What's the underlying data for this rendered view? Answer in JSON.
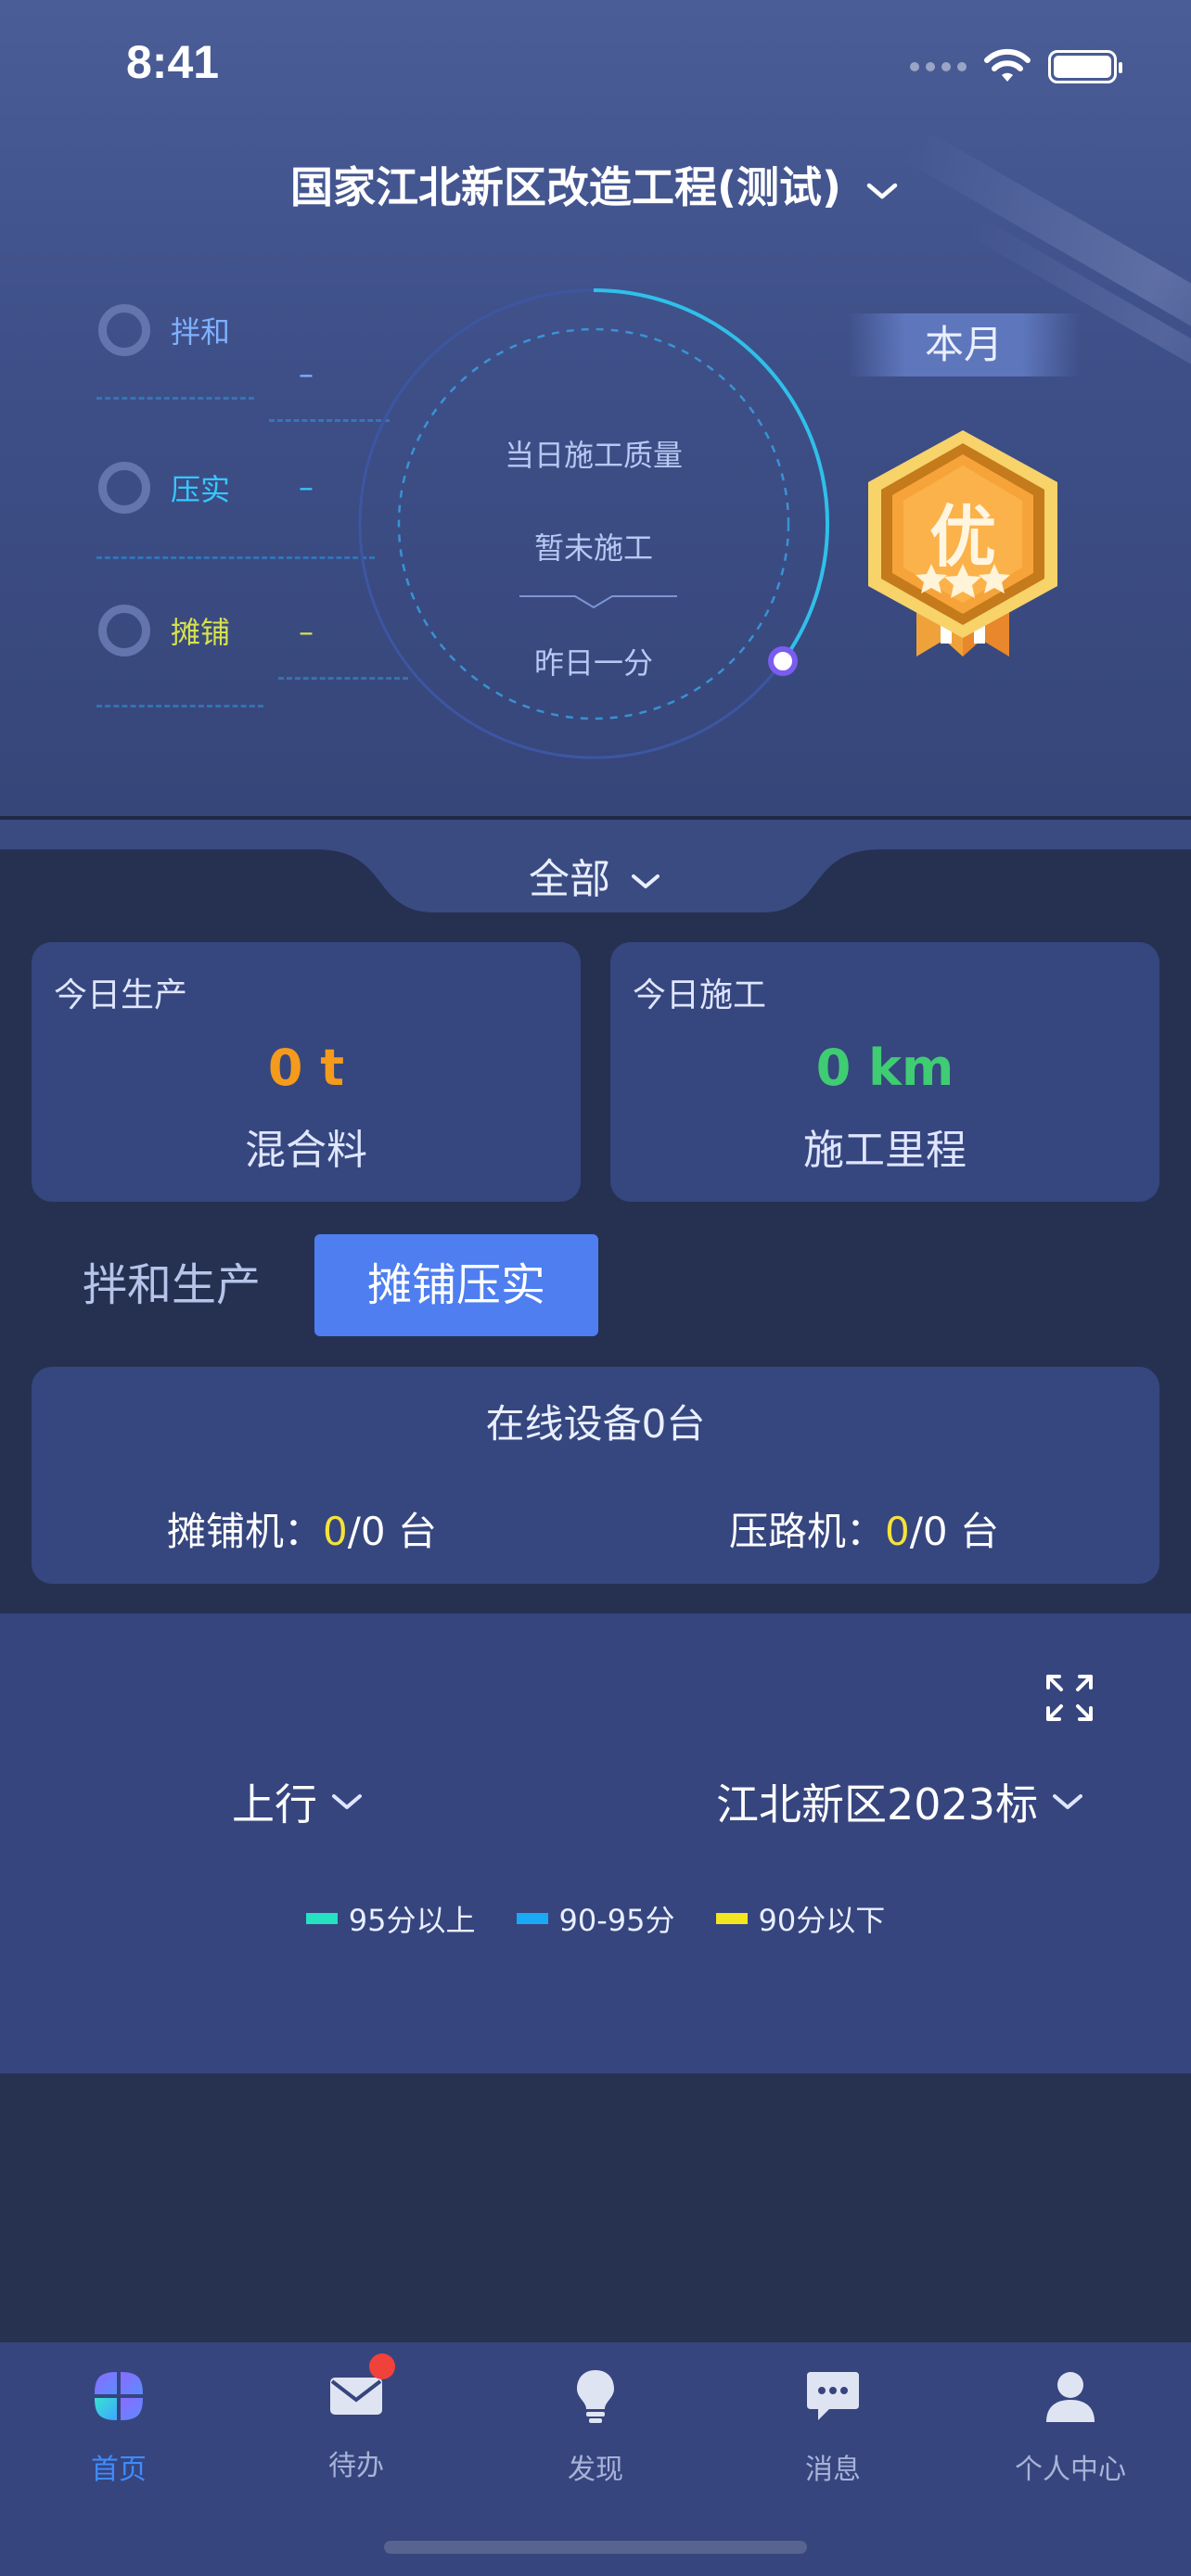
{
  "status_bar": {
    "time": "8:41"
  },
  "header": {
    "project_title": "国家江北新区改造工程(测试)"
  },
  "quality_panel": {
    "items": [
      {
        "label": "拌和",
        "value": "–",
        "color": "#7fb1ff"
      },
      {
        "label": "压实",
        "value": "–",
        "color": "#35c8ff"
      },
      {
        "label": "摊铺",
        "value": "–",
        "color": "#d7e24d"
      }
    ],
    "center_title": "当日施工质量",
    "center_status": "暂未施工",
    "center_footer": "昨日一分",
    "period_badge": "本月",
    "medal_text": "优"
  },
  "scope_selector": {
    "label": "全部"
  },
  "stats": {
    "production": {
      "caption": "今日生产",
      "value": "0 t",
      "sub": "混合料",
      "color": "#f49a1c"
    },
    "construction": {
      "caption": "今日施工",
      "value": "0 km",
      "sub": "施工里程",
      "color": "#3fcc73"
    }
  },
  "segment_tabs": {
    "mixing": "拌和生产",
    "paving": "摊铺压实"
  },
  "devices": {
    "title": "在线设备0台",
    "paver_label": "摊铺机：",
    "paver_online": "0",
    "paver_total": "/0 台",
    "roller_label": "压路机：",
    "roller_online": "0",
    "roller_total": "/0 台"
  },
  "map": {
    "direction": "上行",
    "section": "江北新区2023标",
    "legend": [
      {
        "label": "95分以上",
        "color": "#26e0c2"
      },
      {
        "label": "90-95分",
        "color": "#19a9f5"
      },
      {
        "label": "90分以下",
        "color": "#f3e520"
      }
    ]
  },
  "tabbar": {
    "items": [
      {
        "label": "首页",
        "icon": "home-grid-icon"
      },
      {
        "label": "待办",
        "icon": "mail-icon"
      },
      {
        "label": "发现",
        "icon": "bulb-icon"
      },
      {
        "label": "消息",
        "icon": "chat-icon"
      },
      {
        "label": "个人中心",
        "icon": "person-icon"
      }
    ]
  }
}
